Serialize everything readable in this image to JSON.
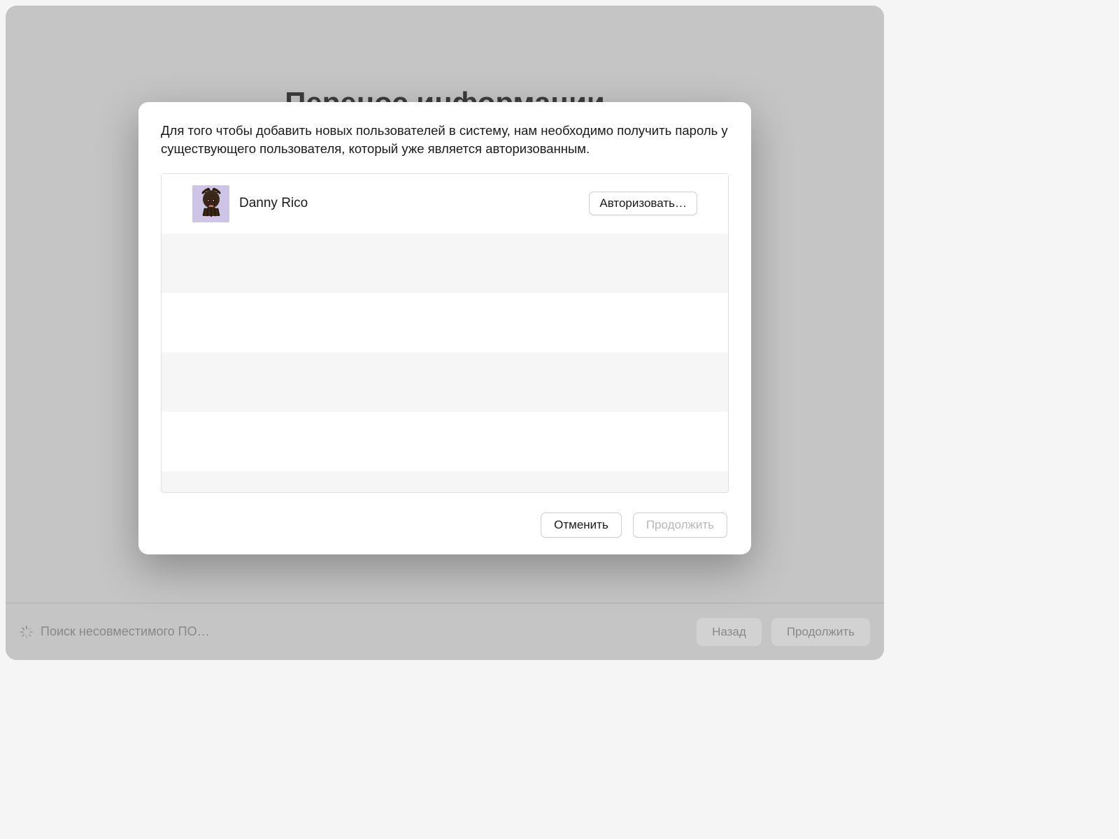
{
  "background": {
    "title": "Перенос информации",
    "statusText": "Поиск несовместимого ПО…",
    "buttons": {
      "back": "Назад",
      "continue": "Продолжить"
    }
  },
  "dialog": {
    "description": "Для того чтобы добавить новых пользователей в систему, нам необходимо получить пароль у существующего пользователя, который уже является авторизованным.",
    "user": {
      "name": "Danny Rico",
      "authorizeLabel": "Авторизовать…"
    },
    "buttons": {
      "cancel": "Отменить",
      "continue": "Продолжить"
    }
  }
}
